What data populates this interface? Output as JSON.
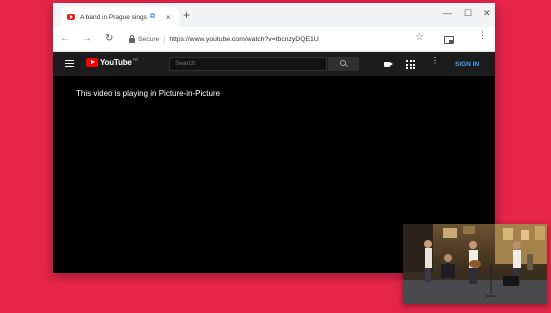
{
  "tab": {
    "title": "A band in Prague sings th",
    "pip_indicator": "⧉",
    "close": "×"
  },
  "new_tab": "+",
  "window_controls": {
    "minimize": "—",
    "maximize": "☐",
    "close": "✕"
  },
  "nav": {
    "back": "←",
    "forward": "→",
    "reload": "↻"
  },
  "omnibox": {
    "secure_label": "Secure",
    "separator": "|",
    "url": "https://www.youtube.com/watch?v=tbcnzyDQE1U"
  },
  "bookmark_star": "☆",
  "menu_dots": "⋮",
  "youtube": {
    "logo_text": "YouTube",
    "region": "TR",
    "search_placeholder": "Search",
    "more_dots": "⋮",
    "sign_in": "SIGN IN"
  },
  "content": {
    "message": "This video is playing in Picture-in-Picture"
  },
  "colors": {
    "background": "#e5254a",
    "youtube_red": "#ff0000",
    "signin_blue": "#3ea6ff"
  }
}
